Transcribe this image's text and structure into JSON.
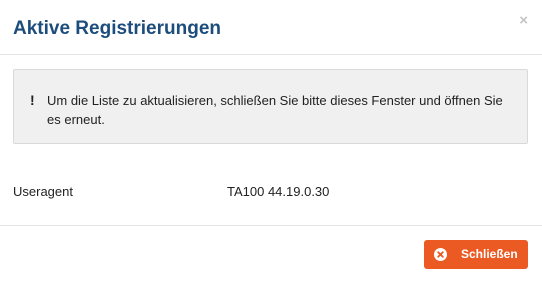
{
  "dialog": {
    "title": "Aktive Registrierungen",
    "close_glyph": "×",
    "alert": {
      "icon_glyph": "!",
      "icon": "exclamation-icon",
      "text": "Um die Liste zu aktualisieren, schließen Sie bitte dieses Fenster und öffnen Sie es erneut."
    },
    "rows": [
      {
        "label": "Useragent",
        "value": "TA100 44.19.0.30"
      }
    ],
    "footer": {
      "close_button_label": "Schließen",
      "close_button_icon": "circle-x-icon"
    }
  },
  "colors": {
    "title": "#1c4d7d",
    "button": "#ec5a24",
    "alert_background": "#f0f0f0",
    "close_x": "#c4c4c4"
  }
}
